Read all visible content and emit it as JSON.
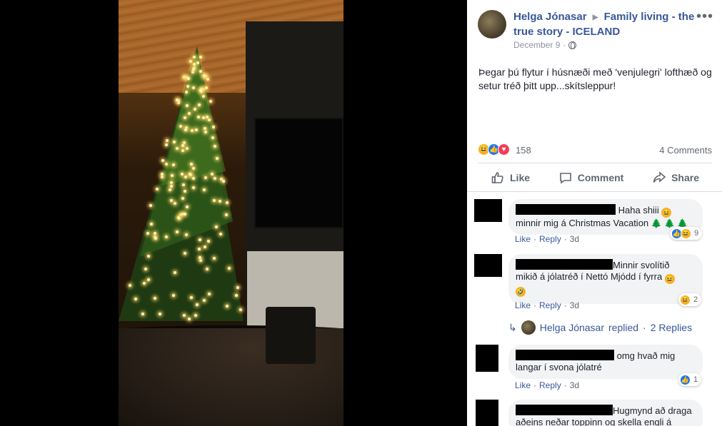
{
  "post": {
    "author": "Helga Jónasar",
    "group": "Family living - the true story - ICELAND",
    "date": "December 9",
    "date_sep": "·",
    "text": "Þegar þú flytur í húsnæði með 'venjulegri' lofthæð og setur tréð þitt upp...skítsleppur!",
    "more_icon": "more-options-icon",
    "privacy_icon": "globe-icon"
  },
  "reactions": {
    "count": "158",
    "types": [
      "haha",
      "like",
      "love"
    ],
    "comments_label": "4 Comments"
  },
  "actions": {
    "like": "Like",
    "comment": "Comment",
    "share": "Share"
  },
  "comments": [
    {
      "text_line1": "Haha shiii",
      "text_line2": "minnir mig á Christmas Vacation",
      "like": "Like",
      "reply": "Reply",
      "time": "3d",
      "reaction_count": "9"
    },
    {
      "text_line1": "Minnir svolítið",
      "text_line2": "mikið á jólatréð í Nettó Mjódd í fyrra",
      "like": "Like",
      "reply": "Reply",
      "time": "3d",
      "reaction_count": "2"
    },
    {
      "text_line1": "omg hvað mig",
      "text_line2": "langar í svona jólatré",
      "like": "Like",
      "reply": "Reply",
      "time": "3d",
      "reaction_count": "1"
    },
    {
      "text_line1": "Hugmynd að draga",
      "text_line2": "aðeins neðar toppinn og skella engli á"
    }
  ],
  "reply_summary": {
    "replier": "Helga Jónasar",
    "replied": "replied",
    "sep": "·",
    "count_label": "2 Replies"
  },
  "colors": {
    "link": "#385898",
    "muted": "#606770",
    "bubble": "#f2f3f5",
    "like_blue": "#1877f2",
    "haha_yellow": "#f7b125",
    "love_red": "#f33e58"
  }
}
